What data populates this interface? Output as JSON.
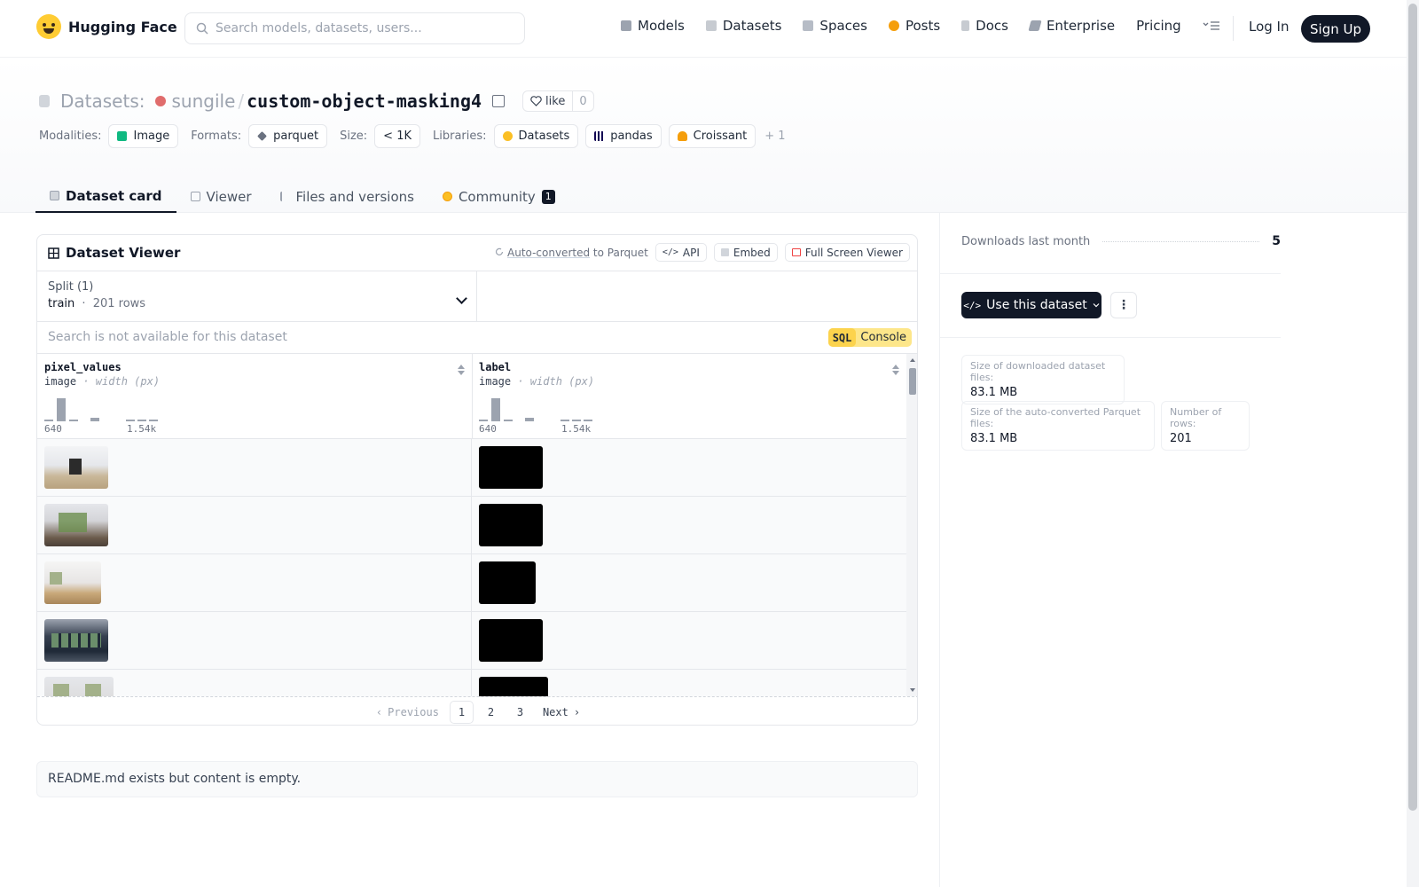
{
  "nav": {
    "logo": "Hugging Face",
    "search_placeholder": "Search models, datasets, users...",
    "links": [
      {
        "label": "Models",
        "color": "#9ca3af"
      },
      {
        "label": "Datasets",
        "color": "#c7cbd1"
      },
      {
        "label": "Spaces",
        "color": "#b6bcc6"
      },
      {
        "label": "Posts",
        "color": "#f59e0b"
      },
      {
        "label": "Docs",
        "color": "#c7cbd1"
      },
      {
        "label": "Enterprise",
        "color": "#9ca3af"
      },
      {
        "label": "Pricing",
        "color": ""
      }
    ],
    "login": "Log In",
    "signup": "Sign Up"
  },
  "header": {
    "prefix": "Datasets:",
    "owner": "sungile",
    "slash": "/",
    "name": "custom-object-masking4",
    "like_label": "like",
    "like_count": "0",
    "modalities_label": "Modalities:",
    "modality": "Image",
    "formats_label": "Formats:",
    "format": "parquet",
    "size_label": "Size:",
    "size": "< 1K",
    "libraries_label": "Libraries:",
    "libraries": [
      "Datasets",
      "pandas",
      "Croissant"
    ],
    "libraries_more": "+ 1"
  },
  "tabs": [
    {
      "label": "Dataset card",
      "active": true
    },
    {
      "label": "Viewer"
    },
    {
      "label": "Files and versions"
    },
    {
      "label": "Community",
      "badge": "1"
    }
  ],
  "viewer": {
    "title": "Dataset Viewer",
    "auto_converted": "Auto-converted",
    "to_parquet": " to Parquet",
    "api": "API",
    "embed": "Embed",
    "fullscreen": "Full Screen Viewer",
    "split_title": "Split (1)",
    "split_name": "train",
    "split_dot": "·",
    "split_rows": "201 rows",
    "search_na": "Search is not available for this dataset",
    "sql_label": "SQL",
    "console_label": "Console",
    "columns": [
      {
        "name": "pixel_values",
        "type": "image",
        "subtitle": "· width (px)",
        "min": "640",
        "max": "1.54k"
      },
      {
        "name": "label",
        "type": "image",
        "subtitle": "· width (px)",
        "min": "640",
        "max": "1.54k"
      }
    ],
    "pagination": {
      "previous": "Previous",
      "pages": [
        "1",
        "2",
        "3"
      ],
      "current": "1",
      "next": "Next"
    }
  },
  "readme": "README.md exists but content is empty.",
  "sidebar": {
    "downloads_label": "Downloads last month",
    "downloads": "5",
    "use_button": "Use this dataset",
    "stats": [
      {
        "label": "Size of downloaded dataset files:",
        "value": "83.1 MB"
      },
      {
        "label": "Size of the auto-converted Parquet files:",
        "value": "83.1 MB"
      },
      {
        "label": "Number of rows:",
        "value": "201"
      }
    ]
  }
}
